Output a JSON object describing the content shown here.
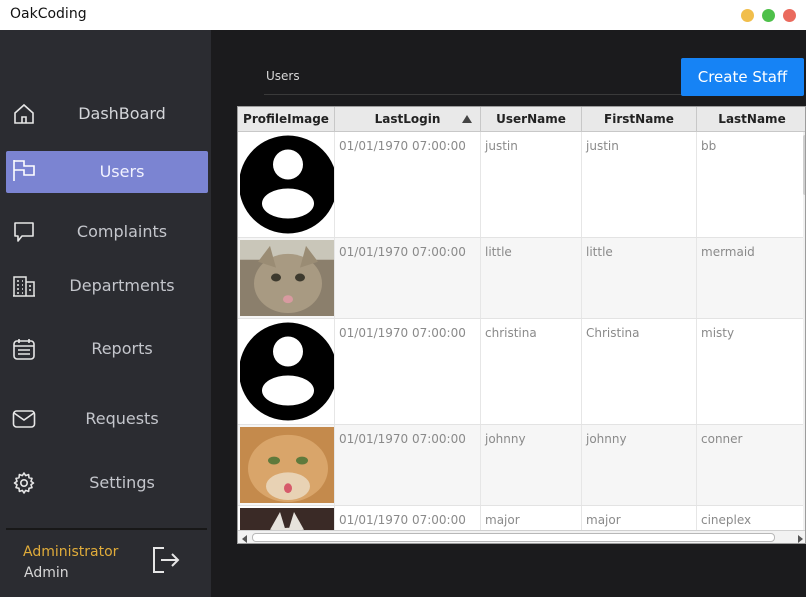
{
  "app": {
    "title": "OakCoding"
  },
  "sidebar": {
    "items": [
      {
        "label": "DashBoard",
        "icon": "home-icon"
      },
      {
        "label": "Users",
        "icon": "flag-icon",
        "active": true
      },
      {
        "label": "Complaints",
        "icon": "chat-bubble-icon"
      },
      {
        "label": "Departments",
        "icon": "building-icon"
      },
      {
        "label": "Reports",
        "icon": "calendar-icon"
      },
      {
        "label": "Requests",
        "icon": "mail-icon"
      },
      {
        "label": "Settings",
        "icon": "gear-icon"
      }
    ],
    "role": "Administrator",
    "username": "Admin"
  },
  "main": {
    "page_label": "Users",
    "create_button": "Create Staff"
  },
  "table": {
    "columns": [
      "ProfileImage",
      "LastLogin",
      "UserName",
      "FirstName",
      "LastName"
    ],
    "sorted_column": "LastLogin",
    "sort_direction": "ascending",
    "rows": [
      {
        "image": "default-avatar",
        "last_login": "01/01/1970 07:00:00",
        "username": "justin",
        "first_name": "justin",
        "last_name": "bb"
      },
      {
        "image": "cat-photo",
        "last_login": "01/01/1970 07:00:00",
        "username": "little",
        "first_name": "little",
        "last_name": "mermaid"
      },
      {
        "image": "default-avatar",
        "last_login": "01/01/1970 07:00:00",
        "username": "christina",
        "first_name": "Christina",
        "last_name": "misty"
      },
      {
        "image": "cat-photo",
        "last_login": "01/01/1970 07:00:00",
        "username": "johnny",
        "first_name": "johnny",
        "last_name": "conner"
      },
      {
        "image": "cat-photo",
        "last_login": "01/01/1970 07:00:00",
        "username": "major",
        "first_name": "major",
        "last_name": "cineplex"
      }
    ]
  },
  "colors": {
    "sidebar_bg": "#2b2c31",
    "main_bg": "#1b1b1d",
    "active_item": "#7b84d2",
    "accent_button": "#1683f5",
    "role_text": "#e0ac3a"
  }
}
